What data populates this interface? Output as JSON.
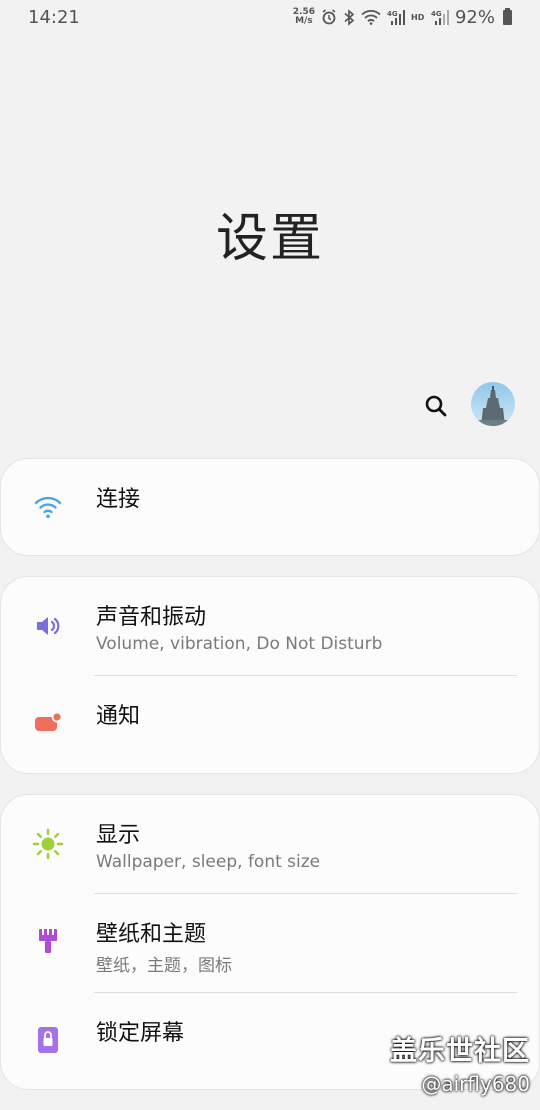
{
  "status_bar": {
    "time": "14:21",
    "net_speed": "2.56",
    "net_speed_unit": "M/s",
    "battery": "92%",
    "icons": [
      "alarm-icon",
      "bluetooth-icon",
      "wifi-icon",
      "signal-4g-icon",
      "hd-icon",
      "signal-4g-icon",
      "battery-icon"
    ]
  },
  "header": {
    "title": "设置"
  },
  "toolbar": {
    "search_icon": "search-icon",
    "avatar": "avatar"
  },
  "settings": [
    {
      "items": [
        {
          "title": "连接",
          "subtitle": "",
          "icon": "wifi-icon",
          "icon_color": "#4aa3df"
        }
      ]
    },
    {
      "items": [
        {
          "title": "声音和振动",
          "subtitle": "Volume, vibration, Do Not Disturb",
          "icon": "speaker-icon",
          "icon_color": "#7b6fde"
        },
        {
          "title": "通知",
          "subtitle": "",
          "icon": "notification-icon",
          "icon_color": "#ef6f5c"
        }
      ]
    },
    {
      "items": [
        {
          "title": "显示",
          "subtitle": "Wallpaper, sleep, font size",
          "icon": "brightness-icon",
          "icon_color": "#9ccf3a"
        },
        {
          "title": "壁纸和主题",
          "subtitle": "壁纸，主题，图标",
          "icon": "paint-brush-icon",
          "icon_color": "#b04ad8"
        },
        {
          "title": "锁定屏幕",
          "subtitle": "",
          "icon": "lock-icon",
          "icon_color": "#a572e8"
        }
      ]
    }
  ],
  "watermark": {
    "main": "盖乐世社区",
    "sub": "@airfly680"
  }
}
